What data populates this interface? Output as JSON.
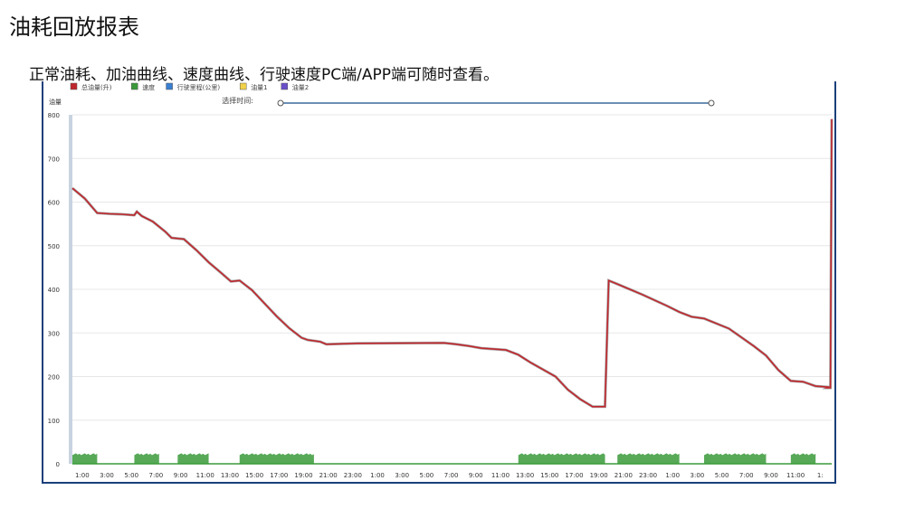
{
  "page": {
    "title": "油耗回放报表",
    "subtitle": "正常油耗、加油曲线、速度曲线、行驶速度PC端/APP端可随时查看。"
  },
  "legend": [
    {
      "label": "总油量(升)",
      "color": "#c0272d"
    },
    {
      "label": "速度",
      "color": "#3a9a3a"
    },
    {
      "label": "行驶里程(公里)",
      "color": "#3a7fd0"
    },
    {
      "label": "油量1",
      "color": "#f2d24a"
    },
    {
      "label": "油量2",
      "color": "#6a4fc9"
    }
  ],
  "range_label": "选择时间:",
  "chart_data": {
    "type": "line",
    "ylabel": "油量",
    "ylim": [
      0,
      800
    ],
    "yticks": [
      0,
      100,
      200,
      300,
      400,
      500,
      600,
      700,
      800
    ],
    "grid": true,
    "legend_position": "top-left",
    "xlim": [
      0,
      60
    ],
    "xtick_positions": [
      1,
      3,
      5,
      7,
      9,
      11,
      13,
      15,
      17,
      19,
      21,
      23,
      25,
      27,
      29,
      31,
      33,
      35,
      37,
      39,
      41,
      43,
      45,
      47,
      49,
      51,
      53,
      55,
      57,
      59,
      61
    ],
    "xtick_labels": [
      "1:00",
      "3:00",
      "5:00",
      "7:00",
      "9:00",
      "11:00",
      "13:00",
      "15:00",
      "17:00",
      "19:00",
      "21:00",
      "23:00",
      "1:00",
      "3:00",
      "5:00",
      "7:00",
      "9:00",
      "11:00",
      "13:00",
      "15:00",
      "17:00",
      "19:00",
      "21:00",
      "23:00",
      "1:00",
      "3:00",
      "5:00",
      "7:00",
      "9:00",
      "11:00",
      "1:"
    ],
    "series": [
      {
        "name": "总油量(升)",
        "color": "#c0272d",
        "points": [
          [
            0,
            632
          ],
          [
            1,
            608
          ],
          [
            2,
            575
          ],
          [
            3,
            573
          ],
          [
            4,
            572
          ],
          [
            5,
            570
          ],
          [
            5.2,
            578
          ],
          [
            5.6,
            568
          ],
          [
            6.5,
            555
          ],
          [
            7.5,
            532
          ],
          [
            8,
            518
          ],
          [
            9,
            515
          ],
          [
            10,
            490
          ],
          [
            11,
            462
          ],
          [
            12,
            438
          ],
          [
            12.8,
            418
          ],
          [
            13.5,
            420
          ],
          [
            14.5,
            398
          ],
          [
            15.5,
            368
          ],
          [
            16.5,
            338
          ],
          [
            17.5,
            311
          ],
          [
            18.5,
            289
          ],
          [
            19,
            284
          ],
          [
            20,
            280
          ],
          [
            20.5,
            274
          ],
          [
            23,
            276
          ],
          [
            30,
            277
          ],
          [
            31,
            274
          ],
          [
            32,
            270
          ],
          [
            33,
            265
          ],
          [
            35,
            261
          ],
          [
            36,
            250
          ],
          [
            37,
            232
          ],
          [
            39,
            200
          ],
          [
            40,
            170
          ],
          [
            41,
            148
          ],
          [
            42,
            131
          ],
          [
            43,
            131
          ],
          [
            43.3,
            420
          ],
          [
            44,
            412
          ],
          [
            45,
            400
          ],
          [
            46,
            388
          ],
          [
            48,
            362
          ],
          [
            49,
            348
          ],
          [
            50,
            337
          ],
          [
            51,
            333
          ],
          [
            53,
            310
          ],
          [
            55,
            270
          ],
          [
            56,
            248
          ],
          [
            57,
            215
          ],
          [
            58,
            190
          ],
          [
            59,
            188
          ],
          [
            60,
            178
          ],
          [
            61,
            176
          ],
          [
            60.9,
            174
          ],
          [
            61.2,
            174
          ],
          [
            61.3,
            790
          ]
        ]
      },
      {
        "name": "速度",
        "color": "#3a9a3a",
        "segments": [
          [
            0,
            2
          ],
          [
            5,
            7
          ],
          [
            8.5,
            11
          ],
          [
            13.5,
            19.5
          ],
          [
            36,
            43
          ],
          [
            44,
            49
          ],
          [
            51,
            56
          ],
          [
            58,
            60
          ]
        ],
        "level": 22
      }
    ]
  }
}
